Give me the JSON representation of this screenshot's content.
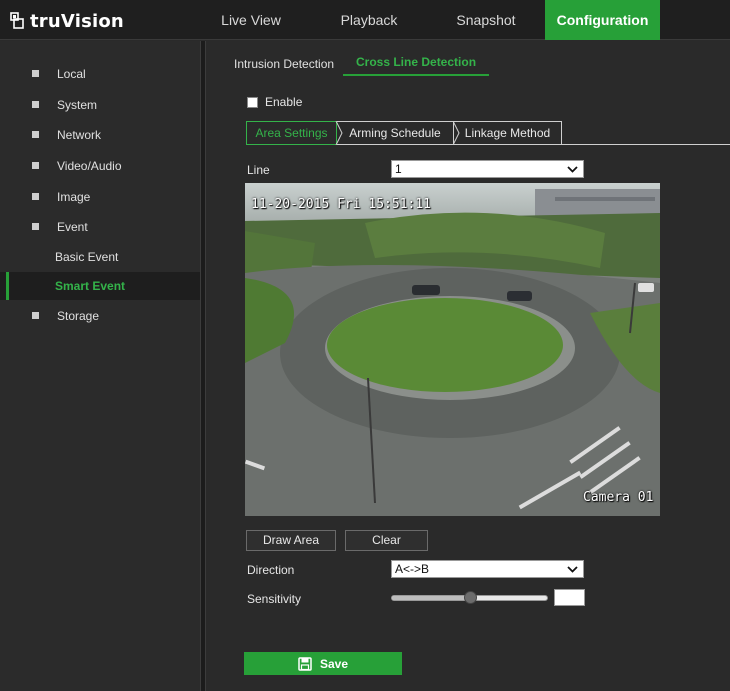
{
  "brand": {
    "name": "truVision"
  },
  "top_nav": [
    {
      "label": "Live View",
      "active": false
    },
    {
      "label": "Playback",
      "active": false
    },
    {
      "label": "Snapshot",
      "active": false
    },
    {
      "label": "Configuration",
      "active": true
    }
  ],
  "sidebar": {
    "items": [
      {
        "label": "Local"
      },
      {
        "label": "System"
      },
      {
        "label": "Network"
      },
      {
        "label": "Video/Audio"
      },
      {
        "label": "Image"
      },
      {
        "label": "Event"
      }
    ],
    "subitems": [
      {
        "label": "Basic Event",
        "active": false
      },
      {
        "label": "Smart Event",
        "active": true
      }
    ],
    "last_item": {
      "label": "Storage"
    }
  },
  "tabs": [
    {
      "label": "Intrusion Detection",
      "active": false
    },
    {
      "label": "Cross Line Detection",
      "active": true
    }
  ],
  "enable": {
    "label": "Enable",
    "checked": false
  },
  "subtabs": [
    {
      "label": "Area Settings",
      "active": true
    },
    {
      "label": "Arming Schedule",
      "active": false
    },
    {
      "label": "Linkage Method",
      "active": false
    }
  ],
  "line": {
    "label": "Line",
    "value": "1"
  },
  "video": {
    "timestamp": "11-20-2015  Fri 15:51:11",
    "camera_name": "Camera 01"
  },
  "buttons": {
    "draw_area": "Draw Area",
    "clear": "Clear",
    "save": "Save"
  },
  "direction": {
    "label": "Direction",
    "value": "A<->B"
  },
  "sensitivity": {
    "label": "Sensitivity",
    "level_percent": 50,
    "value": ""
  },
  "colors": {
    "accent": "#27a038",
    "accent_text": "#34b34a",
    "background": "#2a2a2a"
  },
  "icons": {
    "logo": "truvision-logo-icon",
    "save": "floppy-disk-icon",
    "dropdown": "chevron-down-icon"
  }
}
